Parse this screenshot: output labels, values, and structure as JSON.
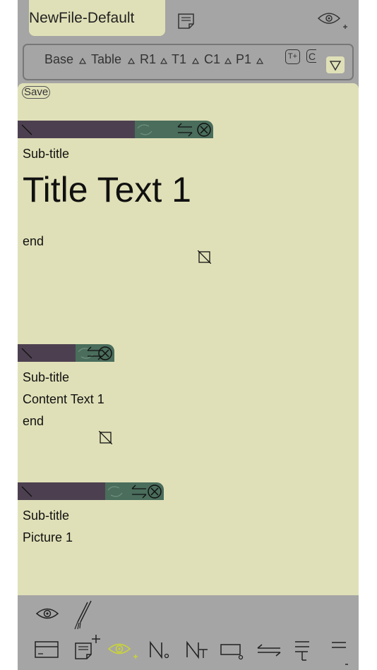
{
  "file": {
    "name": "NewFile-Default"
  },
  "tabs": [
    {
      "label": "Base"
    },
    {
      "label": "Table"
    },
    {
      "label": "R1"
    },
    {
      "label": "T1"
    },
    {
      "label": "C1"
    },
    {
      "label": "P1"
    }
  ],
  "tab_buttons": {
    "add_table": "T+",
    "add_column": "C"
  },
  "save_label": "Save",
  "sections": [
    {
      "subtitle": "Sub-title",
      "title": "Title Text 1",
      "end": "end"
    },
    {
      "subtitle": "Sub-title",
      "content": "Content Text 1",
      "end": "end"
    },
    {
      "subtitle": "Sub-title",
      "content": "Picture 1"
    }
  ],
  "bottom_bar": {
    "row1": [
      "eye-icon",
      "brush-icon"
    ],
    "row2": [
      "card-icon",
      "add-note-icon",
      "eye-add-icon",
      "number-n-icon",
      "number-nt-icon",
      "rectangle-icon",
      "swap-lines-icon",
      "paragraph-format-icon",
      "menu-icon"
    ]
  },
  "colors": {
    "panel": "#e0e0b8",
    "app_bg": "#a5a5a5",
    "toolbar_dark": "#4c4050",
    "toolbar_green": "#4a6d5c",
    "accent": "#c8d23a"
  }
}
